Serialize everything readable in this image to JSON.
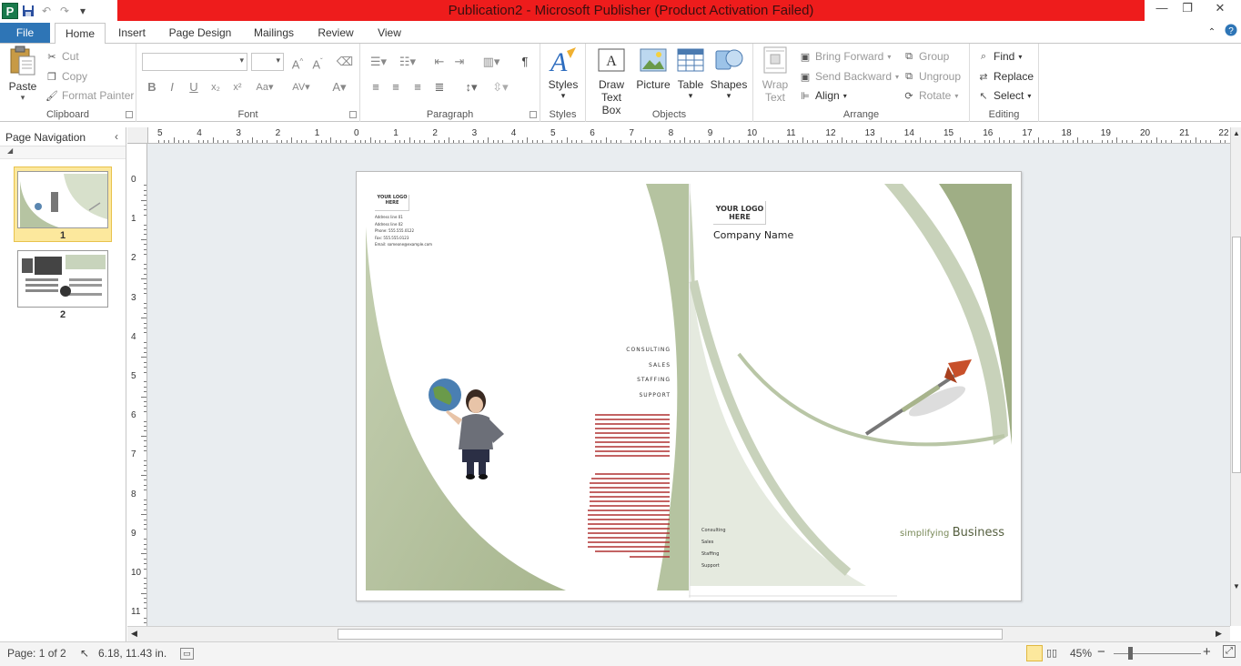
{
  "window": {
    "title": "Publication2 - Microsoft Publisher (Product Activation Failed)",
    "minimize": "—",
    "restore": "❐",
    "close": "✕"
  },
  "qat": {
    "app_icon": "P",
    "save_icon": "save-icon",
    "undo_icon": "undo-icon",
    "redo_icon": "redo-icon",
    "customize_icon": "dropdown-icon"
  },
  "tabs": {
    "file": "File",
    "home": "Home",
    "insert": "Insert",
    "page_design": "Page Design",
    "mailings": "Mailings",
    "review": "Review",
    "view": "View"
  },
  "ribbon": {
    "clipboard": {
      "label": "Clipboard",
      "paste": "Paste",
      "cut": "Cut",
      "copy": "Copy",
      "format_painter": "Format Painter"
    },
    "font": {
      "label": "Font",
      "family": "",
      "size": ""
    },
    "paragraph": {
      "label": "Paragraph",
      "pilcrow": "¶"
    },
    "styles": {
      "label": "Styles",
      "button": "Styles"
    },
    "objects": {
      "label": "Objects",
      "draw_text_box_1": "Draw",
      "draw_text_box_2": "Text Box",
      "picture": "Picture",
      "table": "Table",
      "shapes": "Shapes"
    },
    "arrange": {
      "label": "Arrange",
      "wrap_text_1": "Wrap",
      "wrap_text_2": "Text",
      "bring_forward": "Bring Forward",
      "send_backward": "Send Backward",
      "align": "Align",
      "group": "Group",
      "ungroup": "Ungroup",
      "rotate": "Rotate"
    },
    "editing": {
      "label": "Editing",
      "find": "Find",
      "replace": "Replace",
      "select": "Select"
    }
  },
  "page_navigation": {
    "title": "Page Navigation",
    "pages": [
      {
        "number": "1",
        "selected": true
      },
      {
        "number": "2",
        "selected": false
      }
    ]
  },
  "rulers": {
    "horizontal": [
      "5",
      "4",
      "3",
      "2",
      "1",
      "0",
      "1",
      "2",
      "3",
      "4",
      "5",
      "6",
      "7",
      "8",
      "9",
      "10",
      "11",
      "12",
      "13",
      "14",
      "15",
      "16",
      "17",
      "18",
      "19",
      "20",
      "21",
      "22"
    ],
    "vertical": [
      "0",
      "1",
      "2",
      "3",
      "4",
      "5",
      "6",
      "7",
      "8",
      "9",
      "10",
      "11"
    ]
  },
  "publication": {
    "left_panel": {
      "logo": "YOUR LOGO HERE",
      "address_lines": [
        "Address line 01",
        "Address line 02",
        "Phone: 555.555.0122",
        "Fax: 555.555.0123",
        "Email: someone@example.com"
      ],
      "services": [
        "CONSULTING",
        "SALES",
        "STAFFING",
        "SUPPORT"
      ]
    },
    "right_panel": {
      "logo": "YOUR LOGO HERE",
      "company_name": "Company Name",
      "tagline_small": "simplifying",
      "tagline_big": "Business",
      "services": [
        "Consulting",
        "Sales",
        "Staffing",
        "Support"
      ]
    }
  },
  "status": {
    "page": "Page: 1 of 2",
    "position": "6.18, 11.43 in.",
    "zoom": "45%",
    "zoom_minus": "−",
    "zoom_plus": "+"
  },
  "colors": {
    "accent_green": "#a9b98f",
    "file_tab": "#2e75b6",
    "title_red": "#ee1c1c"
  }
}
